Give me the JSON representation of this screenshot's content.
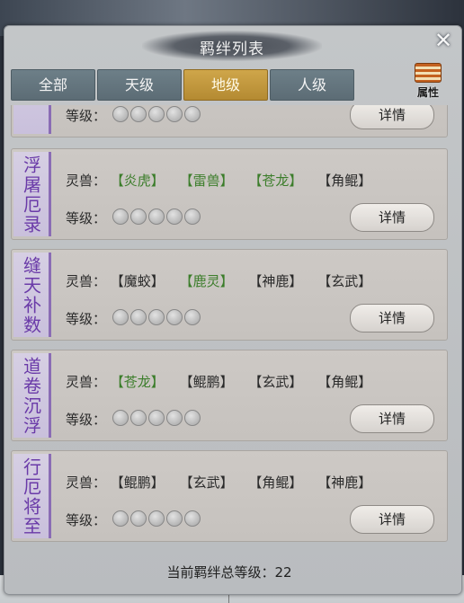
{
  "window": {
    "title": "羁绊列表"
  },
  "tabs": [
    {
      "label": "全部",
      "active": false
    },
    {
      "label": "天级",
      "active": false
    },
    {
      "label": "地级",
      "active": true
    },
    {
      "label": "人级",
      "active": false
    }
  ],
  "attributes_button": {
    "label": "属性"
  },
  "labels": {
    "beasts": "灵兽：",
    "level": "等级：",
    "detail": "详情"
  },
  "bonds": [
    {
      "name": "",
      "beasts": [],
      "level": 0,
      "max_level": 5
    },
    {
      "name": "浮屠厄录",
      "beasts": [
        {
          "name": "【炎虎】",
          "owned": true
        },
        {
          "name": "【雷兽】",
          "owned": true
        },
        {
          "name": "【苍龙】",
          "owned": true
        },
        {
          "name": "【角鲲】",
          "owned": false
        }
      ],
      "level": 0,
      "max_level": 5
    },
    {
      "name": "缝天补数",
      "beasts": [
        {
          "name": "【魔蛟】",
          "owned": false
        },
        {
          "name": "【鹿灵】",
          "owned": true
        },
        {
          "name": "【神鹿】",
          "owned": false
        },
        {
          "name": "【玄武】",
          "owned": false
        }
      ],
      "level": 0,
      "max_level": 5
    },
    {
      "name": "道卷沉浮",
      "beasts": [
        {
          "name": "【苍龙】",
          "owned": true
        },
        {
          "name": "【鲲鹏】",
          "owned": false
        },
        {
          "name": "【玄武】",
          "owned": false
        },
        {
          "name": "【角鲲】",
          "owned": false
        }
      ],
      "level": 0,
      "max_level": 5
    },
    {
      "name": "行厄将至",
      "beasts": [
        {
          "name": "【鲲鹏】",
          "owned": false
        },
        {
          "name": "【玄武】",
          "owned": false
        },
        {
          "name": "【角鲲】",
          "owned": false
        },
        {
          "name": "【神鹿】",
          "owned": false
        }
      ],
      "level": 0,
      "max_level": 5
    }
  ],
  "footer": {
    "total_label": "当前羁绊总等级：",
    "total_value": "22"
  }
}
